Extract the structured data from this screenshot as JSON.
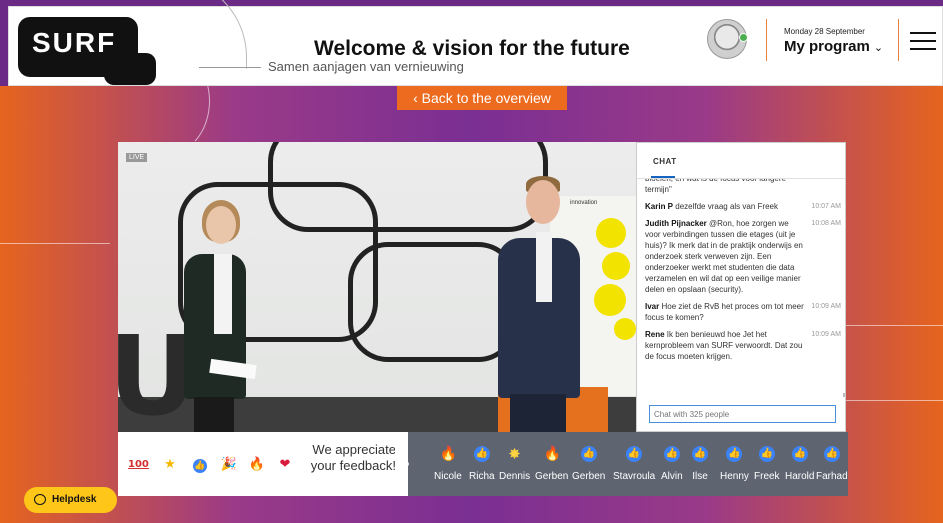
{
  "header": {
    "logo_text": "SURF",
    "title": "Welcome & vision for the future",
    "subtitle": "Samen aanjagen van vernieuwing",
    "date": "Monday 28 September",
    "program_label": "My program"
  },
  "back_button": "‹  Back to the overview",
  "video": {
    "live_label": "LIVE",
    "board_title": "innovation",
    "stage_letter": "U"
  },
  "chat": {
    "tab_label": "CHAT",
    "messages": [
      {
        "name": "",
        "text": "bloeien, en wat is de focus voor langere termijn\"",
        "time": ""
      },
      {
        "name": "Karin P",
        "text": "dezelfde vraag als van Freek",
        "time": "10:07 AM"
      },
      {
        "name": "Judith Pijnacker",
        "text": "@Ron, hoe zorgen we voor verbindingen tussen die etages (uit je huis)? Ik merk dat in de praktijk onderwijs en onderzoek sterk verweven zijn. Een onderzoeker werkt met studenten die data verzamelen en wil dat op een veilige manier delen en opslaan (security).",
        "time": "10:08 AM"
      },
      {
        "name": "Ivar",
        "text": "Hoe ziet de RvB het proces om tot meer focus te komen?",
        "time": "10:09 AM"
      },
      {
        "name": "Rene",
        "text": "Ik ben benieuwd hoe Jet het kernprobleem van SURF verwoordt. Dat zou de focus moeten krijgen.",
        "time": "10:09 AM"
      }
    ],
    "input_placeholder": "Chat with 325 people"
  },
  "reactions": {
    "icons": [
      "100",
      "star",
      "thumbs-up",
      "party-popper",
      "fire",
      "heart"
    ],
    "icon_glyphs": [
      "100",
      "★",
      "👍",
      "🎉",
      "🔥",
      "❤"
    ],
    "appreciate_text": "We appreciate your feedback!"
  },
  "feedback": [
    {
      "icon": "fire",
      "glyph": "🔥",
      "name": "Nicole"
    },
    {
      "icon": "like",
      "glyph": "👍",
      "name": "Richa"
    },
    {
      "icon": "star",
      "glyph": "✸",
      "name": "Dennis"
    },
    {
      "icon": "fire",
      "glyph": "🔥",
      "name": "Gerben"
    },
    {
      "icon": "like",
      "glyph": "👍",
      "name": "Gerben"
    },
    {
      "icon": "like",
      "glyph": "👍",
      "name": "Stavroula"
    },
    {
      "icon": "like",
      "glyph": "👍",
      "name": "Alvin"
    },
    {
      "icon": "like",
      "glyph": "👍",
      "name": "Ilse"
    },
    {
      "icon": "like",
      "glyph": "👍",
      "name": "Henny"
    },
    {
      "icon": "like",
      "glyph": "👍",
      "name": "Freek"
    },
    {
      "icon": "like",
      "glyph": "👍",
      "name": "Harold"
    },
    {
      "icon": "like",
      "glyph": "👍",
      "name": "Farhad"
    }
  ],
  "helpdesk_label": "Helpdesk",
  "colors": {
    "accent_orange": "#ed6b1f",
    "helpdesk_yellow": "#ffc61a",
    "chat_input_border": "#4a90d9"
  }
}
